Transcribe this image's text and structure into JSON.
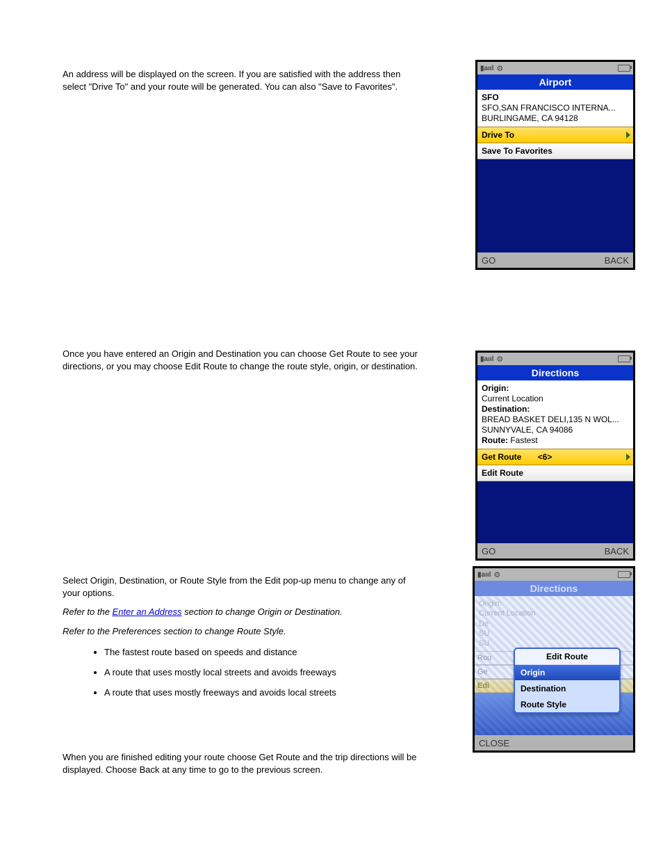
{
  "doc": {
    "p1": "An address will be displayed on the screen. If you are satisfied with the address then select \"Drive To\" and your route will be generated. You can also \"Save to Favorites\".",
    "p2": "Once you have entered an Origin and Destination you can choose Get Route to see your directions, or you may choose Edit Route to change the route style, origin, or destination.",
    "p3": "Select Origin, Destination, or Route Style from the Edit pop-up menu to change any of your options.",
    "p4a": "Refer to the ",
    "p4b": "Enter an Address",
    "p4c": " section to change Origin or Destination.",
    "p5": "Refer to the Preferences section to change Route Style.",
    "p6": "When you are finished editing your route choose Get Route and the trip directions will be displayed. Choose Back at any time to go to the previous screen.",
    "li1": "The fastest route based on speeds and distance",
    "li2": "A route that uses mostly local streets and avoids freeways",
    "li3": "A route that uses mostly freeways and avoids local streets"
  },
  "phoneA": {
    "title": "Airport",
    "code": "SFO",
    "name": "SFO,SAN FRANCISCO INTERNA...",
    "city": "BURLINGAME, CA 94128",
    "opt1": "Drive To",
    "opt2": "Save To Favorites",
    "skL": "GO",
    "skR": "BACK"
  },
  "phoneB": {
    "title": "Directions",
    "originLabel": "Origin:",
    "origin": "Current Location",
    "destLabel": "Destination:",
    "dest1": "BREAD BASKET DELI,135 N WOL...",
    "dest2": "SUNNYVALE, CA 94086",
    "routeLabel": "Route:",
    "routeVal": " Fastest",
    "opt1": "Get Route",
    "shortcut": "<6>",
    "opt2": "Edit Route",
    "skL": "GO",
    "skR": "BACK"
  },
  "phoneC": {
    "title": "Directions",
    "originLabel": "Origin:",
    "origin": "Current Location",
    "destPrefix": "De",
    "su1": "SU",
    "su2": "SU",
    "rou": "Rou",
    "get": "Ge",
    "edi": "Edi",
    "popupTitle": "Edit Route",
    "popOpt1": "Origin",
    "popOpt2": "Destination",
    "popOpt3": "Route Style",
    "skL": "CLOSE"
  },
  "icons": {
    "signal": "▮aııl",
    "gear": "⚙"
  }
}
